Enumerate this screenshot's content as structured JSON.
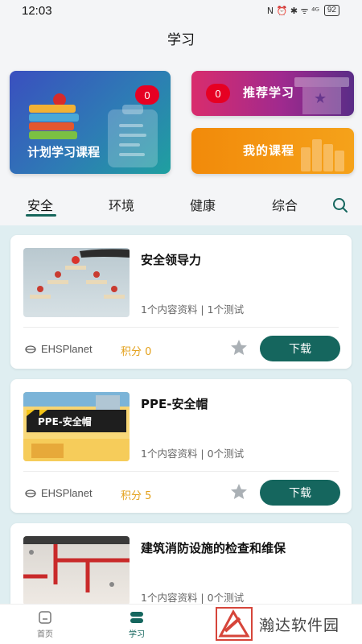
{
  "status_bar": {
    "time": "12:03",
    "icons_text": "N ⏰ ✱ ᯤ ⁴ᴳ",
    "battery": "92"
  },
  "header": {
    "title": "学习"
  },
  "top_cards": {
    "plan": {
      "label": "计划学习课程",
      "badge": "0"
    },
    "recommend": {
      "label": "推荐学习",
      "badge": "0"
    },
    "mine": {
      "label": "我的课程"
    }
  },
  "tabs": [
    {
      "label": "安全",
      "active": true
    },
    {
      "label": "环境",
      "active": false
    },
    {
      "label": "健康",
      "active": false
    },
    {
      "label": "综合",
      "active": false
    }
  ],
  "courses": [
    {
      "title": "安全领导力",
      "meta": "1个内容资料 | 1个测试",
      "provider": "EHSPlanet",
      "points": "积分 0",
      "download": "下载",
      "thumb_icon": "leadership-figures-icon"
    },
    {
      "title": "PPE-安全帽",
      "meta": "1个内容资料 | 0个测试",
      "provider": "EHSPlanet",
      "points": "积分 5",
      "download": "下载",
      "thumb_text": "PPE-安全帽",
      "thumb_icon": "safety-helmet-banner-icon"
    },
    {
      "title": "建筑消防设施的检查和维保",
      "meta": "1个内容资料 | 0个测试",
      "provider": "",
      "points": "",
      "download": "",
      "thumb_icon": "fire-sprinkler-pipes-icon"
    }
  ],
  "tabbar": [
    {
      "label": "首页",
      "icon": "home-icon",
      "active": false
    },
    {
      "label": "学习",
      "icon": "study-icon",
      "active": true
    }
  ],
  "watermark": {
    "text": "瀚达软件园"
  },
  "colors": {
    "accent": "#15665e",
    "badge": "#e60023",
    "points": "#e3a01a"
  }
}
